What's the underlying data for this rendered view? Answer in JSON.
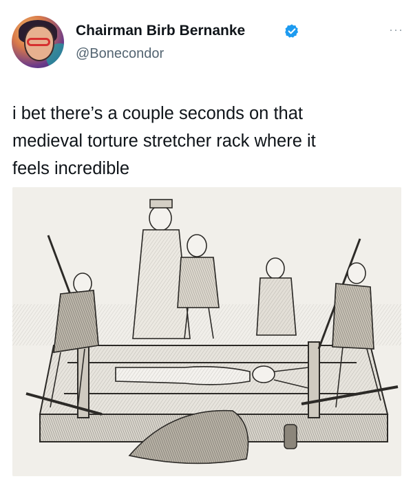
{
  "author": {
    "display_name": "Chairman Birb Bernanke",
    "handle": "@Bonecondor",
    "verified": true,
    "badge_color": "#1d9bf0"
  },
  "menu": {
    "more_label": "···"
  },
  "tweet": {
    "line1": "i bet there’s a couple seconds on that",
    "line2": "medieval torture stretcher rack where it",
    "line3": "feels incredible"
  },
  "media": {
    "kind": "engraving",
    "subject": "medieval-rack-illustration"
  }
}
